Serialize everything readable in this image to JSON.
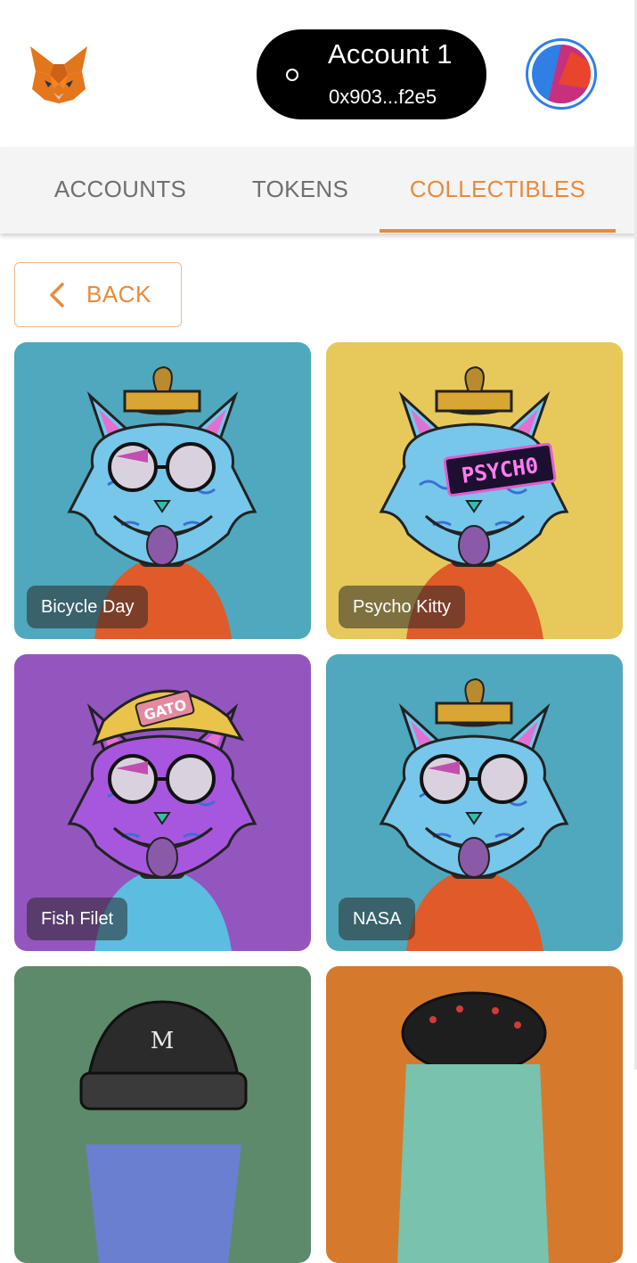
{
  "header": {
    "account_name": "Account 1",
    "account_address": "0x903...f2e5"
  },
  "tabs": [
    {
      "label": "ACCOUNTS",
      "active": false
    },
    {
      "label": "TOKENS",
      "active": false
    },
    {
      "label": "COLLECTIBLES",
      "active": true
    }
  ],
  "back_button": {
    "label": "BACK"
  },
  "collectibles": [
    {
      "name": "Bicycle Day",
      "background": "#4fa8bd",
      "fur": "#76c7ea",
      "outfit": "#e05a2a"
    },
    {
      "name": "Psycho Kitty",
      "background": "#e7c95b",
      "fur": "#76c7ea",
      "outfit": "#e05a2a",
      "visor_text": "PSYCH0"
    },
    {
      "name": "Fish Filet",
      "background": "#9356bf",
      "fur": "#a757dd",
      "outfit": "#5bbde0",
      "hat_text": "GATO"
    },
    {
      "name": "NASA",
      "background": "#4fa8bd",
      "fur": "#76c7ea",
      "outfit": "#e05a2a"
    },
    {
      "name": "",
      "background": "#5d8a6a"
    },
    {
      "name": "",
      "background": "#d57a2d"
    }
  ],
  "colors": {
    "accent": "#e88b3a",
    "tab_inactive": "#6f6f6f",
    "avatar_ring": "#2f7fe4"
  }
}
